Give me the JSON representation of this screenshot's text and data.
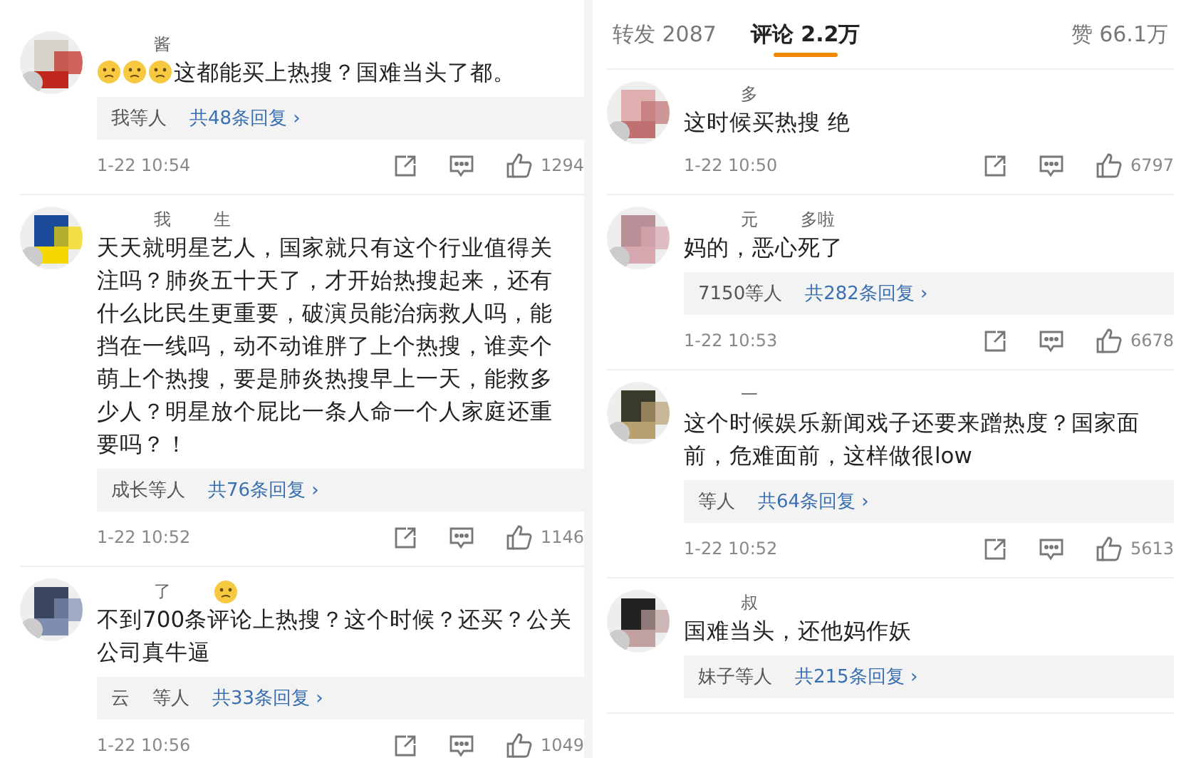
{
  "left_comments": [
    {
      "name_parts": [
        {
          "kind": "text",
          "text": "酱"
        }
      ],
      "lead_emoji": true,
      "text": "这都能买上热搜？国难当头了都。",
      "reply_users": [
        "我等人"
      ],
      "reply_count": "共48条回复",
      "reply_arrow": "›",
      "time": "1-22 10:54",
      "likes": "1294"
    },
    {
      "name_parts": [
        {
          "kind": "text",
          "text": "我"
        },
        {
          "kind": "text",
          "text": "生"
        }
      ],
      "lead_emoji": false,
      "text": "天天就明星艺人，国家就只有这个行业值得关注吗？肺炎五十天了，才开始热搜起来，还有什么比民生更重要，破演员能治病救人吗，能挡在一线吗，动不动谁胖了上个热搜，谁卖个萌上个热搜，要是肺炎热搜早上一天，能救多少人？明星放个屁比一条人命一个人家庭还重要吗？！",
      "reply_users": [
        "成长等人"
      ],
      "reply_count": "共76条回复",
      "reply_arrow": "›",
      "time": "1-22 10:52",
      "likes": "1146"
    },
    {
      "name_parts": [
        {
          "kind": "text",
          "text": "了"
        },
        {
          "kind": "emoji"
        }
      ],
      "lead_emoji": false,
      "text": "不到700条评论上热搜？这个时候？还买？公关公司真牛逼",
      "reply_users": [
        "云",
        "等人"
      ],
      "reply_count": "共33条回复",
      "reply_arrow": "›",
      "time": "1-22 10:56",
      "likes": "1049"
    }
  ],
  "tabs": [
    {
      "label": "转发 2087",
      "selected": false
    },
    {
      "label": "评论 2.2万",
      "selected": true
    }
  ],
  "praise": "赞 66.1万",
  "right_comments": [
    {
      "name_parts": [
        {
          "kind": "text",
          "text": "多"
        }
      ],
      "lead_emoji": false,
      "text": "这时候买热搜 绝",
      "time": "1-22 10:50",
      "likes": "6797"
    },
    {
      "name_parts": [
        {
          "kind": "text",
          "text": "元"
        },
        {
          "kind": "text",
          "text": "多啦"
        }
      ],
      "lead_emoji": false,
      "text": "妈的，恶心死了",
      "reply_users": [
        "7150等人"
      ],
      "reply_count": "共282条回复",
      "reply_arrow": "›",
      "time": "1-22 10:53",
      "likes": "6678"
    },
    {
      "name_parts": [
        {
          "kind": "text",
          "text": "一"
        }
      ],
      "lead_emoji": false,
      "text": "这个时候娱乐新闻戏子还要来蹭热度？国家面前，危难面前，这样做很low",
      "reply_users": [
        "等人"
      ],
      "reply_count": "共64条回复",
      "reply_arrow": "›",
      "time": "1-22 10:52",
      "likes": "5613"
    },
    {
      "name_parts": [
        {
          "kind": "text",
          "text": "叔"
        }
      ],
      "lead_emoji": false,
      "text": "国难当头，还他妈作妖",
      "reply_users": [
        "妹子等人"
      ],
      "reply_count": "共215条回复",
      "reply_arrow": "›"
    }
  ]
}
